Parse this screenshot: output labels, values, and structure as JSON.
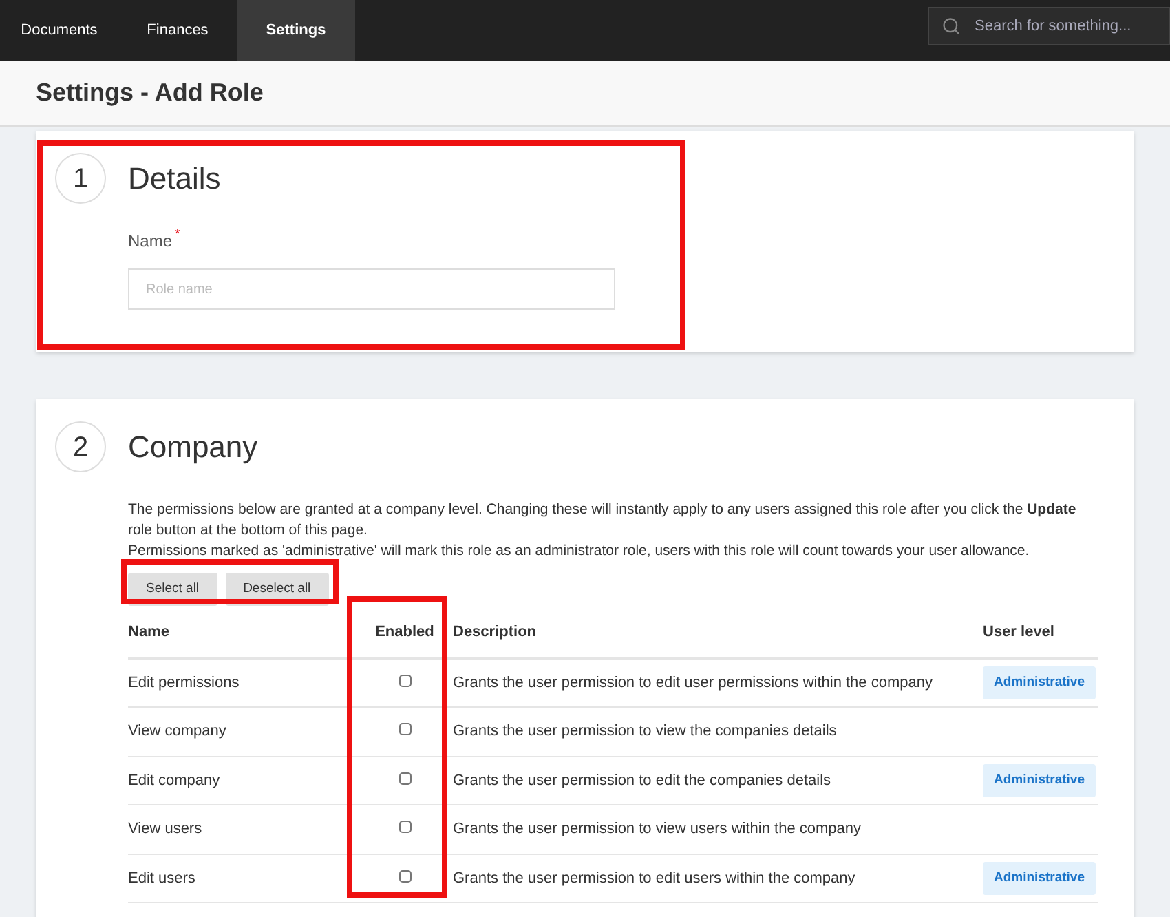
{
  "nav": {
    "tabs": [
      {
        "label": "Documents",
        "selected": false
      },
      {
        "label": "Finances",
        "selected": false
      },
      {
        "label": "Settings",
        "selected": true
      }
    ],
    "search": {
      "placeholder": "Search for something..."
    }
  },
  "page_title": "Settings - Add Role",
  "details": {
    "step": "1",
    "title": "Details",
    "field": {
      "label": "Name",
      "required_mark": "*",
      "placeholder": "Role name"
    }
  },
  "company": {
    "step": "2",
    "title": "Company",
    "intro": "The permissions below are granted at a company level. Changing these will instantly apply to any users assigned this role after you click the **Update** role button at the bottom of this page.",
    "note": "Permissions marked as 'administrative' will mark this role as an administrator role, users with this role will count towards your user allowance.",
    "buttons": [
      "Select all",
      "Deselect all"
    ],
    "table": {
      "columns": [
        "Name",
        "Enabled",
        "Description",
        "User level"
      ],
      "rows": [
        {
          "name": "Edit permissions",
          "checked": false,
          "description": "Grants the user permission to edit user permissions within the company",
          "user_level": "Administrative"
        },
        {
          "name": "View company",
          "checked": false,
          "description": "Grants the user permission to view the companies details"
        },
        {
          "name": "Edit company",
          "checked": false,
          "description": "Grants the user permission to edit the companies details",
          "user_level": "Administrative"
        },
        {
          "name": "View users",
          "checked": false,
          "description": "Grants the user permission to view users within the company"
        },
        {
          "name": "Edit users",
          "checked": false,
          "description": "Grants the user permission to edit users within the company",
          "user_level": "Administrative"
        }
      ]
    }
  }
}
